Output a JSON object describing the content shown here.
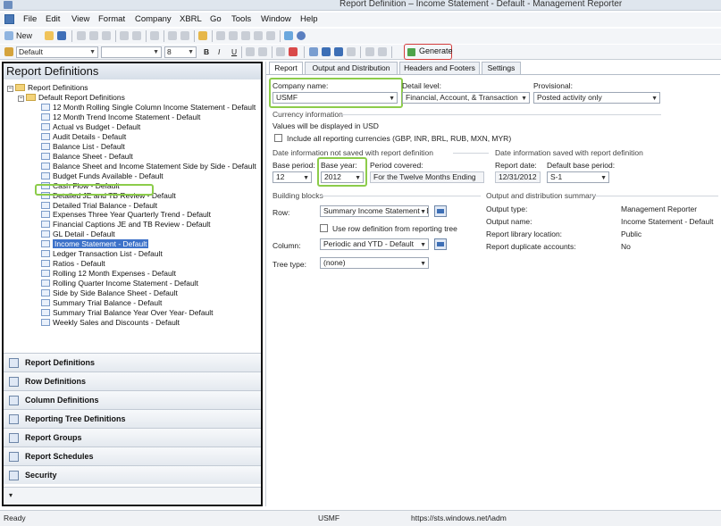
{
  "window": {
    "title": "Report Definition – Income Statement  - Default - Management Reporter"
  },
  "menu": [
    "File",
    "Edit",
    "View",
    "Format",
    "Company",
    "XBRL",
    "Go",
    "Tools",
    "Window",
    "Help"
  ],
  "toolbar": {
    "new_label": "New",
    "style_value": "Default",
    "font_size": "8",
    "generate_label": "Generate",
    "bold": "B",
    "italic": "I",
    "underline": "U"
  },
  "left": {
    "title": "Report Definitions",
    "root": "Report Definitions",
    "folder": "Default Report Definitions",
    "items": [
      "12 Month Rolling Single Column Income Statement - Default",
      "12 Month Trend  Income Statement - Default",
      "Actual vs Budget - Default",
      "Audit Details - Default",
      "Balance List - Default",
      "Balance Sheet - Default",
      "Balance Sheet and Income Statement Side by Side - Default",
      "Budget Funds Available - Default",
      "Cash Flow - Default",
      "Detailed JE and TB Review - Default",
      "Detailed Trial Balance - Default",
      "Expenses Three Year Quarterly Trend - Default",
      "Financial Captions JE and TB Review - Default",
      "GL Detail - Default",
      "Income Statement  - Default",
      "Ledger Transaction List - Default",
      "Ratios - Default",
      "Rolling 12 Month Expenses - Default",
      "Rolling Quarter Income Statement - Default",
      "Side by Side Balance Sheet - Default",
      "Summary Trial Balance - Default",
      "Summary Trial Balance Year Over Year- Default",
      "Weekly Sales and Discounts - Default"
    ],
    "nav": [
      "Report Definitions",
      "Row Definitions",
      "Column Definitions",
      "Reporting Tree Definitions",
      "Report Groups",
      "Report Schedules",
      "Security"
    ]
  },
  "tabs": [
    "Report",
    "Output and Distribution",
    "Headers and Footers",
    "Settings"
  ],
  "report": {
    "company_label": "Company name:",
    "company_value": "USMF",
    "detail_label": "Detail level:",
    "detail_value": "Financial, Account, & Transaction",
    "provisional_label": "Provisional:",
    "provisional_value": "Posted activity only",
    "currency_header": "Currency information",
    "currency_note": "Values will be displayed in USD",
    "include_currencies": "Include all reporting currencies (GBP, INR, BRL, RUB, MXN, MYR)",
    "date_not_saved": "Date information not saved with report definition",
    "date_saved": "Date information saved with report definition",
    "base_period_label": "Base period:",
    "base_period_value": "12",
    "base_year_label": "Base year:",
    "base_year_value": "2012",
    "period_covered_label": "Period covered:",
    "period_covered_value": "For the Twelve Months Ending",
    "report_date_label": "Report date:",
    "report_date_value": "12/31/2012",
    "default_base_label": "Default base period:",
    "default_base_value": "S-1",
    "building_blocks": "Building blocks",
    "row_label": "Row:",
    "row_value": "Summary Income Statement - D",
    "use_row_def": "Use row definition from reporting tree",
    "column_label": "Column:",
    "column_value": "Periodic and YTD - Default",
    "tree_label": "Tree type:",
    "tree_value": "(none)",
    "summary_header": "Output and distribution summary",
    "summary": [
      {
        "k": "Output type:",
        "v": "Management Reporter"
      },
      {
        "k": "Output name:",
        "v": "Income Statement - Default"
      },
      {
        "k": "Report library location:",
        "v": "Public"
      },
      {
        "k": "Report duplicate accounts:",
        "v": "No"
      }
    ]
  },
  "status": {
    "left": "Ready",
    "company": "USMF",
    "url": "https://sts.windows.net/\\adm"
  }
}
